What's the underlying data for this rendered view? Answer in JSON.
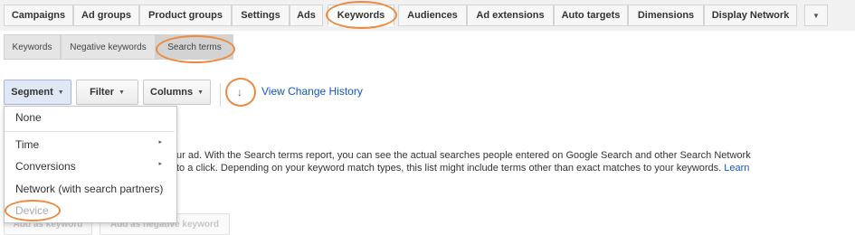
{
  "top_tabs": [
    {
      "label": "Campaigns"
    },
    {
      "label": "Ad groups"
    },
    {
      "label": "Product groups"
    },
    {
      "label": "Settings"
    },
    {
      "label": "Ads"
    },
    {
      "label": "Keywords",
      "active": true
    },
    {
      "label": "Audiences"
    },
    {
      "label": "Ad extensions"
    },
    {
      "label": "Auto targets"
    },
    {
      "label": "Dimensions"
    },
    {
      "label": "Display Network"
    },
    {
      "label": "▼"
    }
  ],
  "sub_tabs": [
    {
      "label": "Keywords"
    },
    {
      "label": "Negative keywords"
    },
    {
      "label": "Search terms",
      "active": true
    }
  ],
  "toolbar": {
    "segment_label": "Segment",
    "filter_label": "Filter",
    "columns_label": "Columns",
    "download_icon": "↓",
    "history_link": "View Change History"
  },
  "segment_menu": {
    "items": [
      {
        "label": "None"
      },
      {
        "label": "Time",
        "submenu": true
      },
      {
        "label": "Conversions",
        "submenu": true
      },
      {
        "label": "Network (with search partners)"
      },
      {
        "label": "Device",
        "disabled": true
      }
    ],
    "arrow_icon": "▸"
  },
  "body": {
    "line1": "ur ad. With the Search terms report, you can see the actual searches people entered on Google Search and other Search Network",
    "line2_text": "to a click. Depending on your keyword match types, this list might include terms other than exact matches to your keywords.",
    "line2_link": "Learn"
  },
  "actions": {
    "add_keyword": "Add as keyword",
    "add_negative": "Add as negative keyword"
  },
  "accent_color": "#ec8b40",
  "link_color": "#1155cc"
}
